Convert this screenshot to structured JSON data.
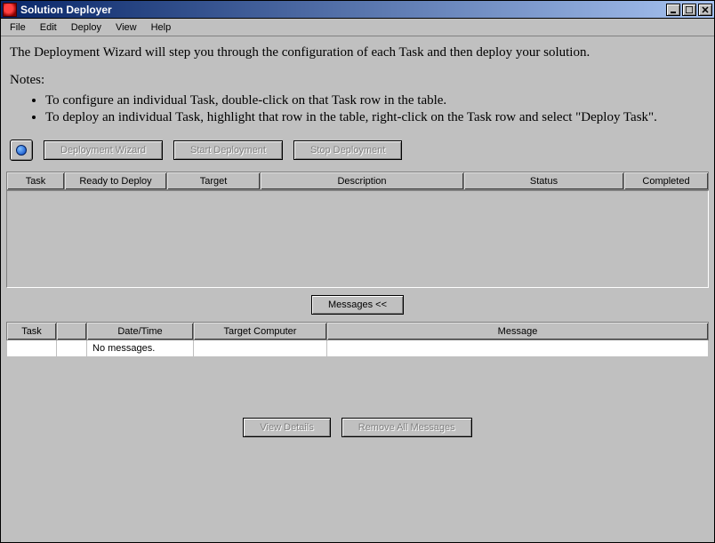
{
  "window": {
    "title": "Solution Deployer"
  },
  "menu": {
    "file": "File",
    "edit": "Edit",
    "deploy": "Deploy",
    "view": "View",
    "help": "Help"
  },
  "content": {
    "intro": "The Deployment Wizard will step you through the configuration of each Task and then deploy your solution.",
    "notes_label": "Notes:",
    "note1": "To configure an individual Task, double-click on that Task row in the table.",
    "note2": "To deploy an individual Task, highlight that row in the table, right-click on the Task row and select \"Deploy Task\"."
  },
  "toolbar": {
    "wizard": "Deployment Wizard",
    "start": "Start Deployment",
    "stop": "Stop Deployment"
  },
  "task_table": {
    "headers": {
      "task": "Task",
      "ready": "Ready to Deploy",
      "target": "Target",
      "description": "Description",
      "status": "Status",
      "completed": "Completed"
    }
  },
  "messages": {
    "toggle": "Messages <<",
    "headers": {
      "task": "Task",
      "icon": "",
      "datetime": "Date/Time",
      "target": "Target Computer",
      "message": "Message"
    },
    "row1": {
      "task": "",
      "icon": "",
      "datetime": "No messages.",
      "target": "",
      "message": ""
    }
  },
  "bottom": {
    "view_details": "View Details",
    "remove_all": "Remove All Messages"
  }
}
